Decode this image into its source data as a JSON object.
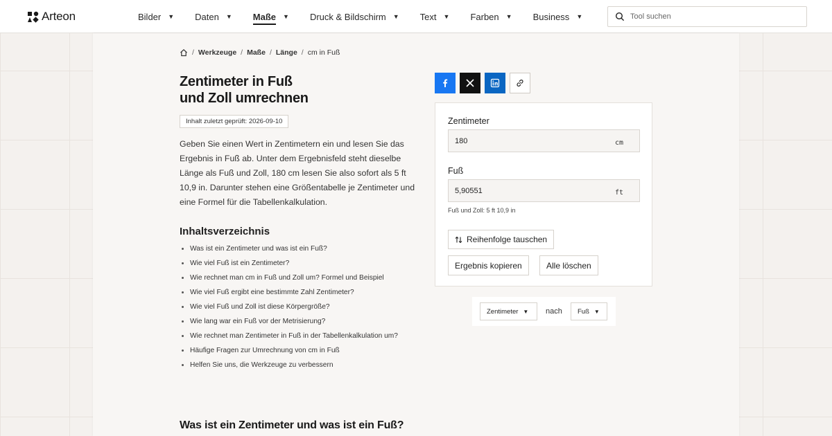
{
  "header": {
    "logo_text": "Arteon",
    "nav": [
      {
        "label": "Bilder",
        "active": false
      },
      {
        "label": "Daten",
        "active": false
      },
      {
        "label": "Maße",
        "active": true
      },
      {
        "label": "Druck & Bildschirm",
        "active": false
      },
      {
        "label": "Text",
        "active": false
      },
      {
        "label": "Farben",
        "active": false
      },
      {
        "label": "Business",
        "active": false
      }
    ],
    "search_placeholder": "Tool suchen"
  },
  "breadcrumb": {
    "items": [
      "Werkzeuge",
      "Maße",
      "Länge"
    ],
    "current": "cm in Fuß"
  },
  "page": {
    "title_line1": "Zentimeter in Fuß",
    "title_line2": "und Zoll umrechnen",
    "checked": "Inhalt zuletzt geprüft: 2026-09-10",
    "intro": "Geben Sie einen Wert in Zentimetern ein und lesen Sie das Ergebnis in Fuß ab. Unter dem Ergebnisfeld steht dieselbe Länge als Fuß und Zoll, 180 cm lesen Sie also sofort als 5 ft 10,9 in. Darunter stehen eine Größentabelle je Zentimeter und eine Formel für die Tabellenkalkulation.",
    "toc_title": "Inhaltsverzeichnis",
    "toc": [
      "Was ist ein Zentimeter und was ist ein Fuß?",
      "Wie viel Fuß ist ein Zentimeter?",
      "Wie rechnet man cm in Fuß und Zoll um? Formel und Beispiel",
      "Wie viel Fuß ergibt eine bestimmte Zahl Zentimeter?",
      "Wie viel Fuß und Zoll ist diese Körpergröße?",
      "Wie lang war ein Fuß vor der Metrisierung?",
      "Wie rechnet man Zentimeter in Fuß in der Tabellenkalkulation um?",
      "Häufige Fragen zur Umrechnung von cm in Fuß",
      "Helfen Sie uns, die Werkzeuge zu verbessern"
    ],
    "section_heading": "Was ist ein Zentimeter und was ist ein Fuß?"
  },
  "converter": {
    "from_label": "Zentimeter",
    "from_value": "180",
    "from_unit": "cm",
    "to_label": "Fuß",
    "to_value": "5,90551",
    "to_unit": "ft",
    "feet_inches": "Fuß und Zoll: 5 ft 10,9 in",
    "swap_label": "Reihenfolge tauschen",
    "copy_label": "Ergebnis kopieren",
    "clear_label": "Alle löschen"
  },
  "unit_selector": {
    "from": "Zentimeter",
    "connector": "nach",
    "to": "Fuß"
  },
  "colors": {
    "facebook": "#1877f2",
    "x": "#111111",
    "linkedin": "#0a66c2"
  }
}
